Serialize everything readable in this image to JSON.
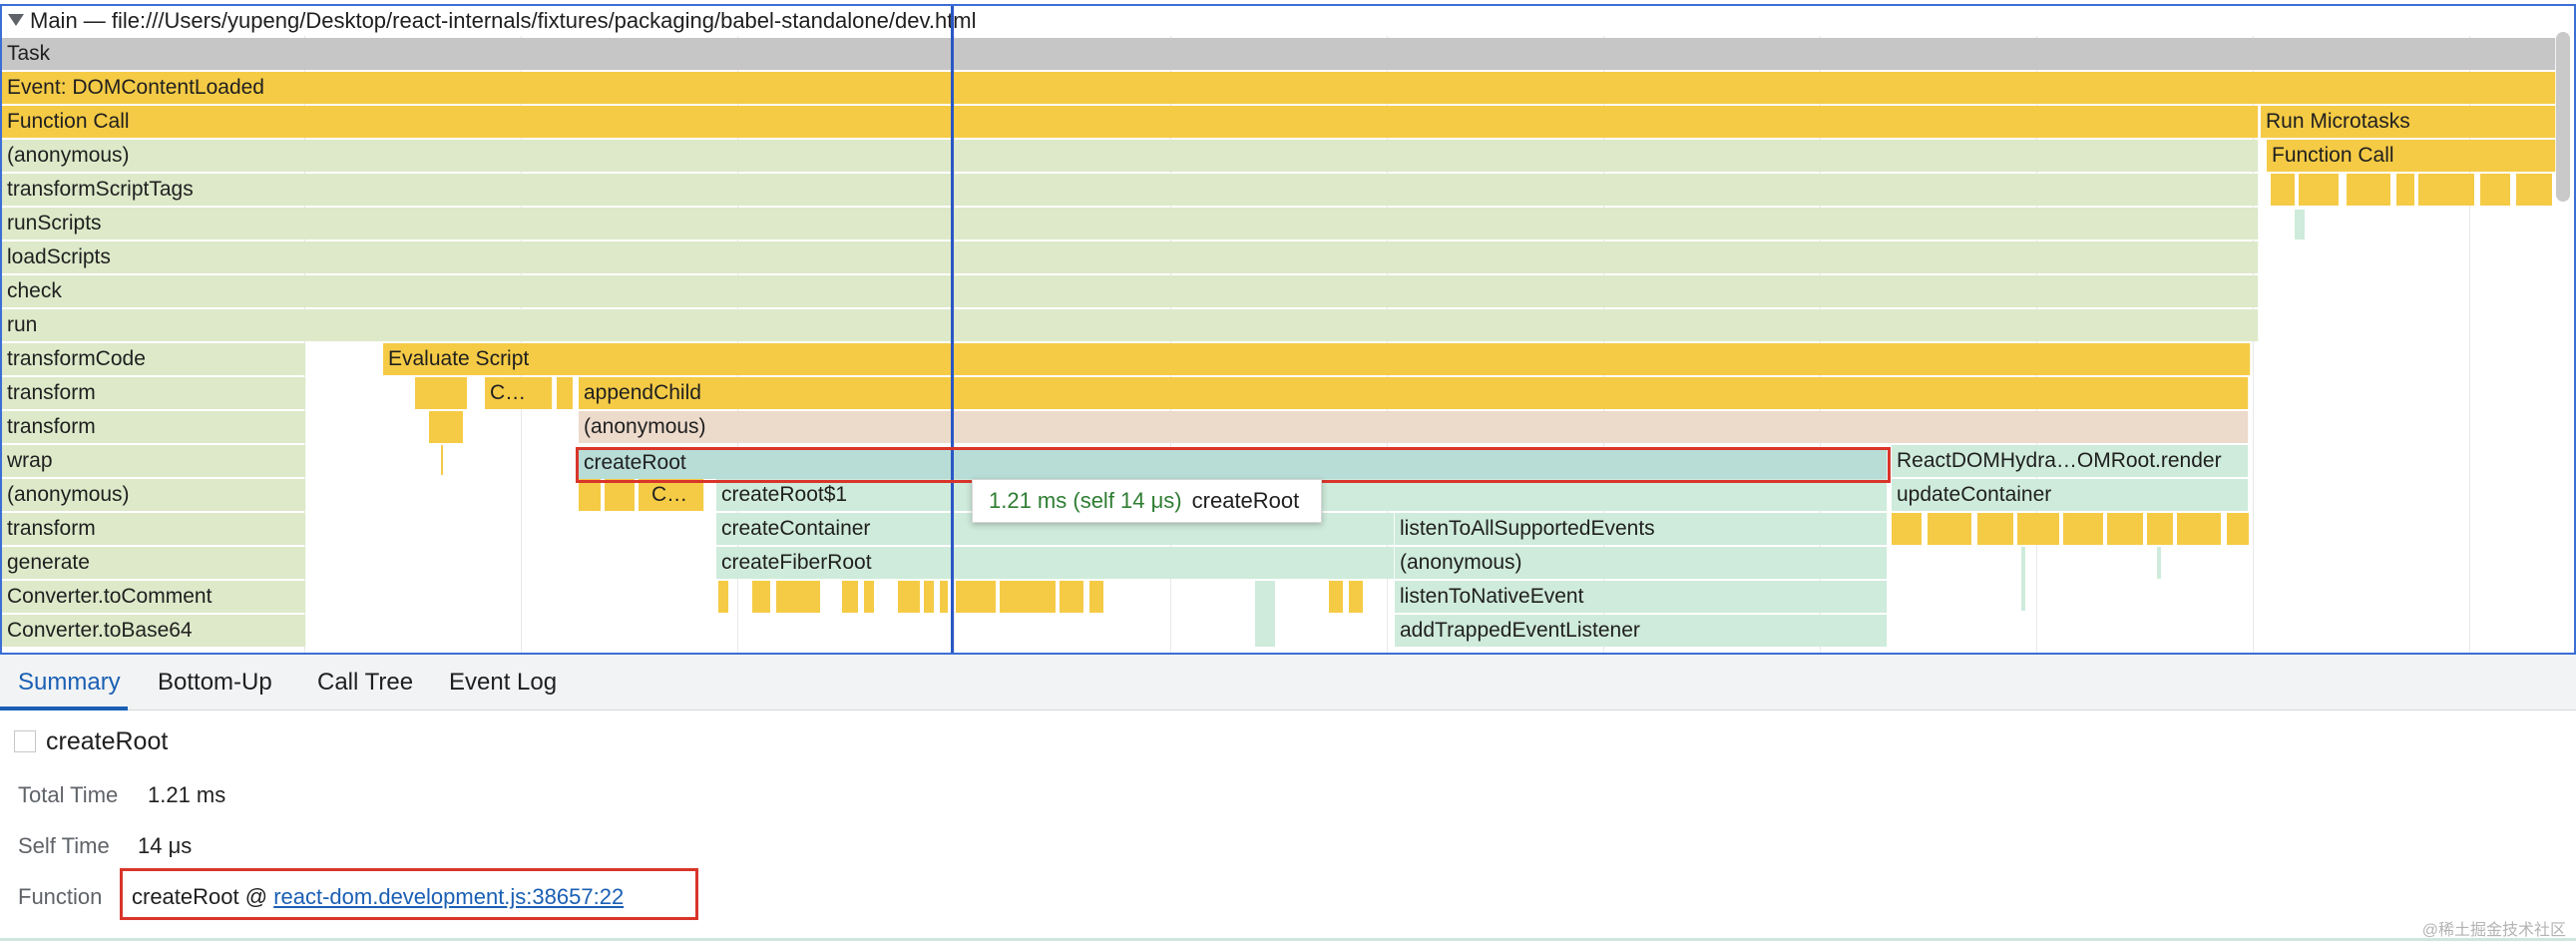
{
  "track": {
    "title": "Main — file:///Users/yupeng/Desktop/react-internals/fixtures/packaging/babel-standalone/dev.html"
  },
  "flame": {
    "rows_left": [
      "Task",
      "Event: DOMContentLoaded",
      "Function Call",
      "(anonymous)",
      "transformScriptTags",
      "runScripts",
      "loadScripts",
      "check",
      "run",
      "transformCode",
      "transform",
      "transform",
      "wrap",
      "(anonymous)",
      "transform",
      "generate",
      "Converter.toComment",
      "Converter.toBase64"
    ],
    "evaluate_script": "Evaluate Script",
    "c_ellipsis": "C…",
    "append_child": "appendChild",
    "anonymous": "(anonymous)",
    "create_root": "createRoot",
    "react_dom_render": "ReactDOMHydra…OMRoot.render",
    "c_ellipsis2": "C…",
    "create_root_1": "createRoot$1",
    "update_container": "updateContainer",
    "create_container": "createContainer",
    "listen_all": "listenToAllSupportedEvents",
    "create_fiber_root": "createFiberRoot",
    "anonymous2": "(anonymous)",
    "listen_native": "listenToNativeEvent",
    "add_trapped": "addTrappedEventListener",
    "run_microtasks": "Run Microtasks",
    "function_call2": "Function Call"
  },
  "tooltip": {
    "time": "1.21 ms (self 14 μs)",
    "name": "createRoot"
  },
  "tabs": [
    "Summary",
    "Bottom-Up",
    "Call Tree",
    "Event Log"
  ],
  "summary": {
    "title": "createRoot",
    "total_time_label": "Total Time",
    "total_time": "1.21 ms",
    "self_time_label": "Self Time",
    "self_time": "14 μs",
    "function_label": "Function",
    "function_name": "createRoot @ ",
    "function_link": "react-dom.development.js:38657:22"
  },
  "watermark": "@稀土掘金技术社区",
  "colors": {
    "scripting": "#f5cb46",
    "selected_outline": "#d9352b",
    "cursor": "#2a57c5"
  }
}
